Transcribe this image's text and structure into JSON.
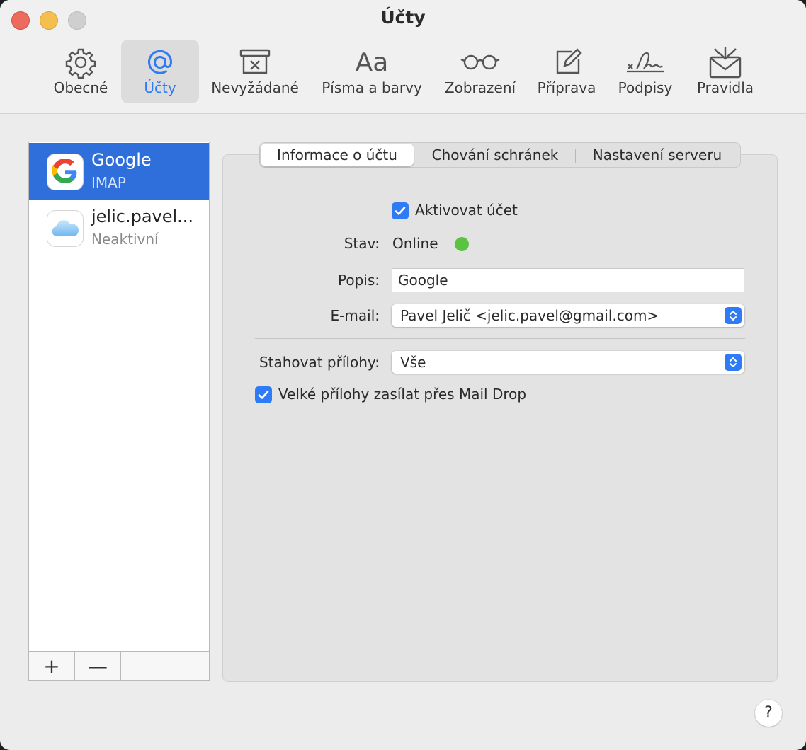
{
  "window": {
    "title": "Účty"
  },
  "toolbar": {
    "items": [
      {
        "label": "Obecné",
        "icon": "gear-icon"
      },
      {
        "label": "Účty",
        "icon": "at-sign-icon",
        "active": true
      },
      {
        "label": "Nevyžádané",
        "icon": "junk-bin-icon"
      },
      {
        "label": "Písma a barvy",
        "icon": "fonts-icon",
        "glyph": "Aa"
      },
      {
        "label": "Zobrazení",
        "icon": "glasses-icon"
      },
      {
        "label": "Příprava",
        "icon": "compose-icon"
      },
      {
        "label": "Podpisy",
        "icon": "signature-icon"
      },
      {
        "label": "Pravidla",
        "icon": "rules-envelope-icon"
      }
    ]
  },
  "accounts": [
    {
      "name": "Google",
      "type": "IMAP",
      "icon": "google-logo-icon",
      "selected": true
    },
    {
      "name": "jelic.pavel...",
      "type": "Neaktivní",
      "icon": "icloud-icon",
      "selected": false
    }
  ],
  "sidebar_buttons": {
    "add": "+",
    "remove": "—"
  },
  "tabs": [
    {
      "label": "Informace o účtu",
      "active": true
    },
    {
      "label": "Chování schránek"
    },
    {
      "label": "Nastavení serveru"
    }
  ],
  "form": {
    "enable_account_label": "Aktivovat účet",
    "enable_account_checked": true,
    "status_label": "Stav:",
    "status_value": "Online",
    "status_color": "#5ac341",
    "description_label": "Popis:",
    "description_value": "Google",
    "email_label": "E-mail:",
    "email_value": "Pavel Jelič <jelic.pavel@gmail.com>",
    "download_label": "Stahovat přílohy:",
    "download_value": "Vše",
    "maildrop_label": "Velké přílohy zasílat přes Mail Drop",
    "maildrop_checked": true
  },
  "help": "?",
  "colors": {
    "accent": "#2f7bf5",
    "selection": "#2f6fdb"
  }
}
